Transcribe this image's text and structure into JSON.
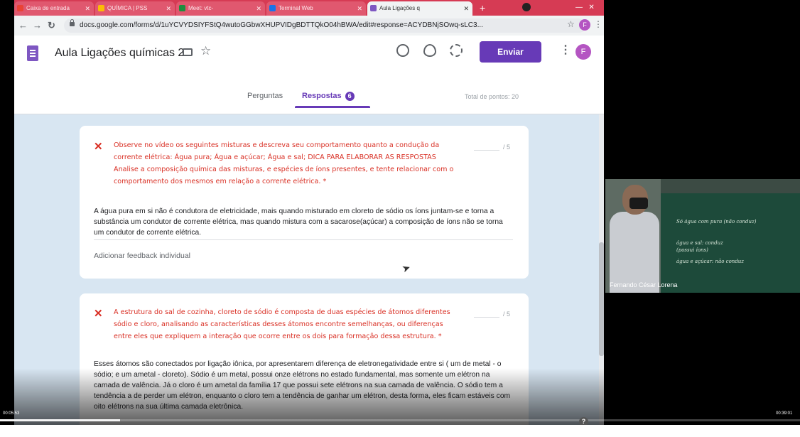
{
  "browser": {
    "tabs": [
      {
        "label": "Caixa de entrada",
        "fav": "#ea4335"
      },
      {
        "label": "QUÍMICA | PSS",
        "fav": "#fbbc04"
      },
      {
        "label": "Meet: vtc-",
        "fav": "#1e8e3e"
      },
      {
        "label": "Terminal Web",
        "fav": "#1a73e8"
      },
      {
        "label": "Aula Ligações q",
        "fav": "#7e57c2"
      }
    ],
    "url": "docs.google.com/forms/d/1uYCVYDSIYFStQ4wutoGGbwXHUPVIDgBDTTQkO04hBWA/edit#response=ACYDBNjSOwq-sLC3...",
    "avatar_letter": "F"
  },
  "forms": {
    "title": "Aula Ligações químicas 2",
    "send_label": "Enviar",
    "avatar_letter": "F",
    "tab_questions": "Perguntas",
    "tab_responses": "Respostas",
    "responses_count": "6",
    "total_points": "Total de pontos: 20"
  },
  "questions": [
    {
      "text": "Observe no vídeo os seguintes misturas e descreva seu comportamento quanto a condução da corrente elétrica: Água pura; Água e açúcar; Água e sal; DICA PARA ELABORAR AS RESPOSTAS Analise a composição química das misturas, e espécies de íons presentes, e tente relacionar com o comportamento dos mesmos em relação a corrente elétrica. *",
      "score": "/ 5",
      "answer": "A água pura em si não é condutora de eletricidade, mais quando misturado em cloreto de sódio os íons juntam-se e torna a substância um condutor de corrente elétrica, mas quando mistura com a sacarose(açúcar) a composição de íons não se torna um condutor de corrente elétrica.",
      "feedback": "Adicionar feedback individual"
    },
    {
      "text": "A estrutura do sal de cozinha, cloreto de sódio é composta de duas espécies de átomos diferentes sódio e cloro, analisando as características desses átomos encontre semelhanças, ou diferenças entre eles que expliquem a interação que ocorre entre os dois para formação dessa estrutura. *",
      "score": "/ 5",
      "answer": "Esses átomos são conectados por ligação iônica, por apresentarem diferença de eletronegatividade entre si ( um de metal - o sódio; e um ametal - cloreto). Sódio é um metal, possui onze elétrons no estado fundamental, mas somente um elétron na camada de valência. Já o cloro é um ametal da família 17 que possui sete elétrons na sua camada de valência. O sódio tem a tendência a de perder um elétron, enquanto o cloro tem a tendência de ganhar um elétron, desta forma, eles ficam estáveis com oito elétrons na sua última camada eletrônica."
    }
  ],
  "webcam": {
    "name": "Fernando César Lorena",
    "chalk_lines": [
      "Só água com pura (não conduz)",
      "água e sal: conduz",
      "(possui íons)",
      "água e açúcar: não conduz"
    ]
  },
  "player": {
    "time_elapsed": "00:05:53",
    "time_total": "00:39:01",
    "progress": 0.15,
    "help": "?"
  }
}
